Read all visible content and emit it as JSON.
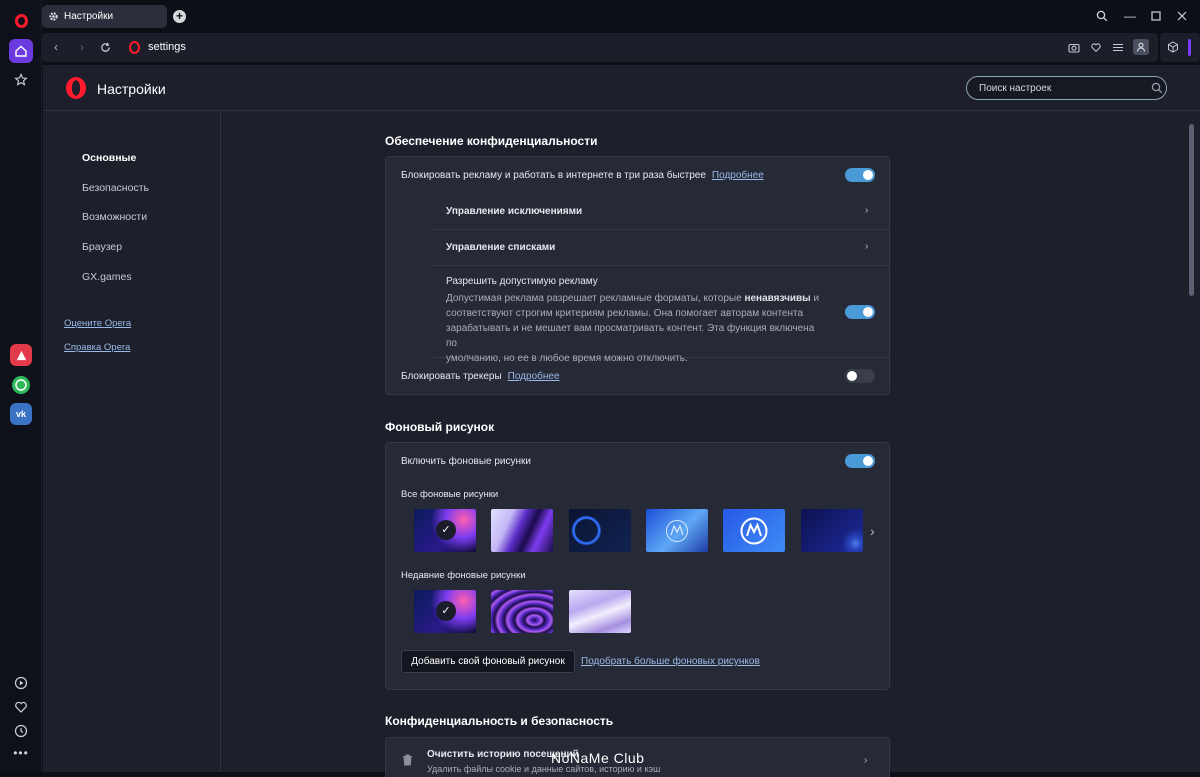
{
  "tab": {
    "title": "Настройки"
  },
  "address": {
    "url": "settings"
  },
  "page": {
    "title": "Настройки",
    "search_placeholder": "Поиск настроек"
  },
  "nav": {
    "items": [
      "Основные",
      "Безопасность",
      "Возможности",
      "Браузер",
      "GX.games"
    ],
    "links": [
      "Оцените Opera",
      "Справка Opera"
    ]
  },
  "privacy": {
    "title": "Обеспечение конфиденциальности",
    "block_ads": "Блокировать рекламу и работать в интернете в три раза быстрее",
    "more": "Подробнее",
    "manage_exceptions": "Управление исключениями",
    "manage_lists": "Управление списками",
    "acceptable_ads_title": "Разрешить допустимую рекламу",
    "acceptable_ads_desc_1": "Допустимая реклама разрешает рекламные форматы, которые",
    "acceptable_ads_bold": "ненавязчивы",
    "acceptable_ads_desc_1b": "и",
    "acceptable_ads_desc_2": "соответствуют строгим критериям рекламы. Она помогает авторам контента",
    "acceptable_ads_desc_3": "зарабатывать и не мешает вам просматривать контент. Эта функция включена по",
    "acceptable_ads_desc_4": "умолчанию, но ее в любое время можно отключить.",
    "block_trackers": "Блокировать трекеры",
    "toggles": {
      "block_ads": true,
      "acceptable_ads": true,
      "block_trackers": false
    }
  },
  "wallpaper": {
    "title": "Фоновый рисунок",
    "enable": "Включить фоновые рисунки",
    "all": "Все фоновые рисунки",
    "recent": "Недавние фоновые рисунки",
    "add_button": "Добавить свой фоновый рисунок",
    "more_link": "Подобрать больше фоновых рисунков",
    "toggle_on": true
  },
  "security": {
    "title": "Конфиденциальность и безопасность",
    "clear_history": "Очистить историю посещений",
    "clear_history_sub": "Удалить файлы cookie и данные сайтов, историю и кэш"
  },
  "watermark": "NoNaMe Club",
  "colors": {
    "accent": "#4a9ad8",
    "opera_red": "#ff1b2d",
    "link": "#9bb9e8"
  }
}
